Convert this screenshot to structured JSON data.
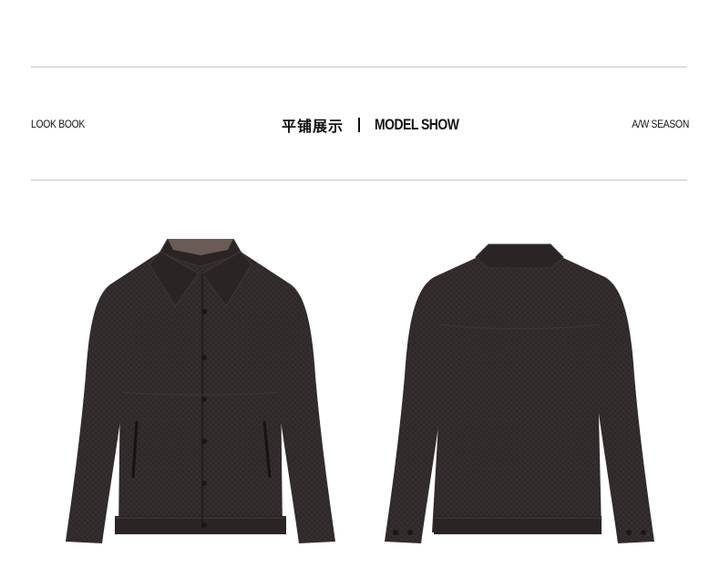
{
  "header": {
    "left_label": "LOOK BOOK",
    "title_cn": "平铺展示",
    "title_en": "MODEL SHOW",
    "right_label": "A/W SEASON"
  },
  "products": [
    {
      "view": "front",
      "color": "#2e2727"
    },
    {
      "view": "back",
      "color": "#2e2727"
    }
  ]
}
